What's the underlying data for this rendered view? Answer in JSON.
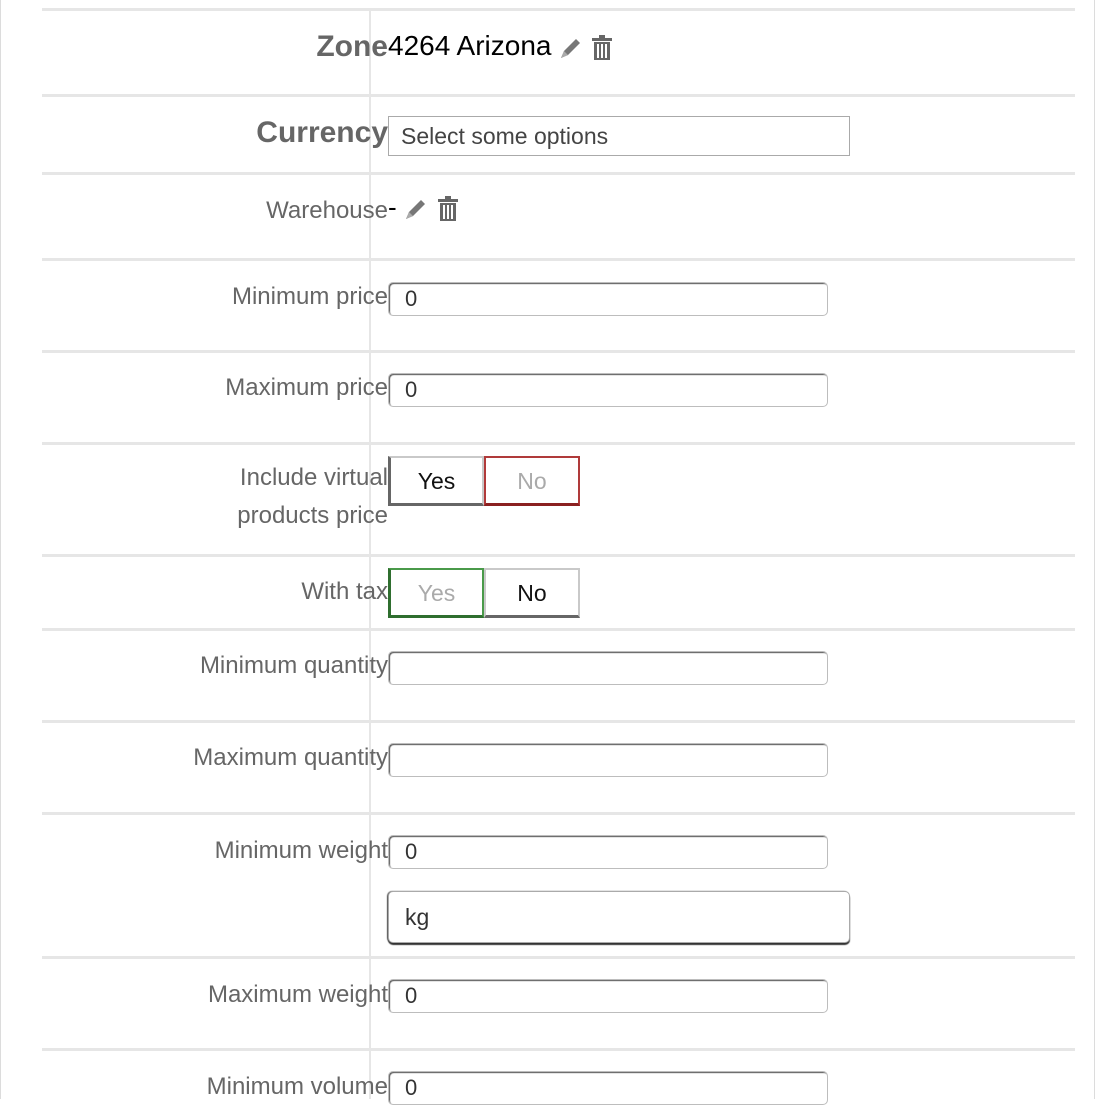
{
  "zone": {
    "label": "Zone",
    "value": "4264 Arizona"
  },
  "currency": {
    "label": "Currency",
    "placeholder": "Select some options"
  },
  "warehouse": {
    "label": "Warehouse",
    "value": "-"
  },
  "minimum_price": {
    "label": "Minimum price",
    "value": "0"
  },
  "maximum_price": {
    "label": "Maximum price",
    "value": "0"
  },
  "include_virtual": {
    "label_line1": "Include virtual",
    "label_line2": "products price",
    "yes": "Yes",
    "no": "No",
    "selected": "No"
  },
  "with_tax": {
    "label": "With tax",
    "yes": "Yes",
    "no": "No",
    "selected": "Yes"
  },
  "minimum_quantity": {
    "label": "Minimum quantity",
    "value": ""
  },
  "maximum_quantity": {
    "label": "Maximum quantity",
    "value": ""
  },
  "minimum_weight": {
    "label": "Minimum weight",
    "value": "0",
    "unit": "kg"
  },
  "maximum_weight": {
    "label": "Maximum weight",
    "value": "0"
  },
  "minimum_volume": {
    "label": "Minimum volume",
    "value": "0"
  },
  "colors": {
    "no_selected": "#b03a3a",
    "yes_selected": "#4a9a4a"
  },
  "icons": [
    "pencil-icon",
    "trash-icon"
  ]
}
